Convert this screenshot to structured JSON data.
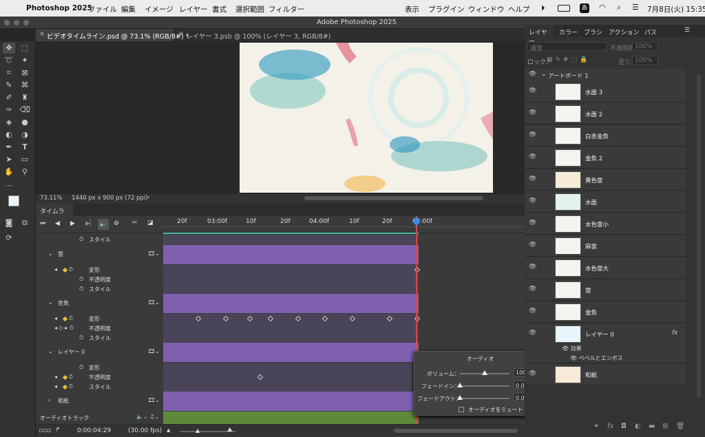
{
  "menubar": {
    "app": "Photoshop 2025",
    "items": [
      "ファイル",
      "編集",
      "イメージ",
      "レイヤー",
      "書式",
      "選択範囲",
      "フィルター",
      "表示",
      "プラグイン",
      "ウィンドウ",
      "ヘルプ"
    ],
    "clock": "7月8日(火) 15:35",
    "ime": "あ"
  },
  "window": {
    "title": "Adobe Photoshop 2025"
  },
  "docs": [
    {
      "label": "ビデオタイムライン.psd @ 73.1% (RGB/8#) *"
    },
    {
      "label": "レイヤー 3.psb @ 100% (レイヤー 3, RGB/8#)"
    }
  ],
  "status": {
    "zoom": "73.11%",
    "info": "1440 px x 900 px (72 ppi)",
    "arrow": "›"
  },
  "timeline": {
    "tab": "タイムライン",
    "ruler": [
      "20f",
      "03:00f",
      "10f",
      "20f",
      "04:00f",
      "10f",
      "20f",
      "05:00f"
    ],
    "rows": [
      {
        "label": "スタイル",
        "kind": "prop"
      },
      {
        "label": "雲",
        "kind": "layer"
      },
      {
        "label": "変形",
        "kind": "prop"
      },
      {
        "label": "不透明度",
        "kind": "prop"
      },
      {
        "label": "スタイル",
        "kind": "prop"
      },
      {
        "label": "金魚",
        "kind": "layer"
      },
      {
        "label": "変形",
        "kind": "prop"
      },
      {
        "label": "不透明度",
        "kind": "prop"
      },
      {
        "label": "スタイル",
        "kind": "prop"
      },
      {
        "label": "レイヤー 0",
        "kind": "layer"
      },
      {
        "label": "変形",
        "kind": "prop"
      },
      {
        "label": "不透明度",
        "kind": "prop"
      },
      {
        "label": "スタイル",
        "kind": "prop"
      },
      {
        "label": "和紙",
        "kind": "layer"
      }
    ],
    "audio_track": "オーディオトラック",
    "timecode": "0:00:04:29",
    "fps": "(30.00 fps)"
  },
  "audio_popup": {
    "title": "オーディオ",
    "volume_label": "ボリューム：",
    "volume": "100%",
    "fadein_label": "フェードイン：",
    "fadein": "0.00 秒",
    "fadeout_label": "フェードアウト：",
    "fadeout": "0.00 秒",
    "mute_label": "オーディオをミュート",
    "volume_fraction": 0.5,
    "fadein_fraction": 0,
    "fadeout_fraction": 0
  },
  "panel": {
    "tabs": [
      "レイヤー",
      "カラー",
      "ブラシ",
      "アクション",
      "パス"
    ],
    "blend": "通常",
    "opacity_label": "不透明度：",
    "opacity": "100%",
    "lock_label": "ロック：",
    "fill_label": "塗り：",
    "fill": "100%",
    "artboard": "アートボード 1",
    "layers": [
      "水面 3",
      "水面 2",
      "白赤金魚",
      "金魚 2",
      "黄色雲",
      "水面",
      "水色雲小",
      "麻雲",
      "水色雲大",
      "雲",
      "金魚",
      "レイヤー 0",
      "和紙"
    ],
    "effects": "効果",
    "bevel": "ベベルとエンボス",
    "fx": "fx"
  },
  "colors": {
    "purple": "#7e5fb0",
    "green": "#5f8a3a",
    "playhead": "#d34b4b"
  }
}
